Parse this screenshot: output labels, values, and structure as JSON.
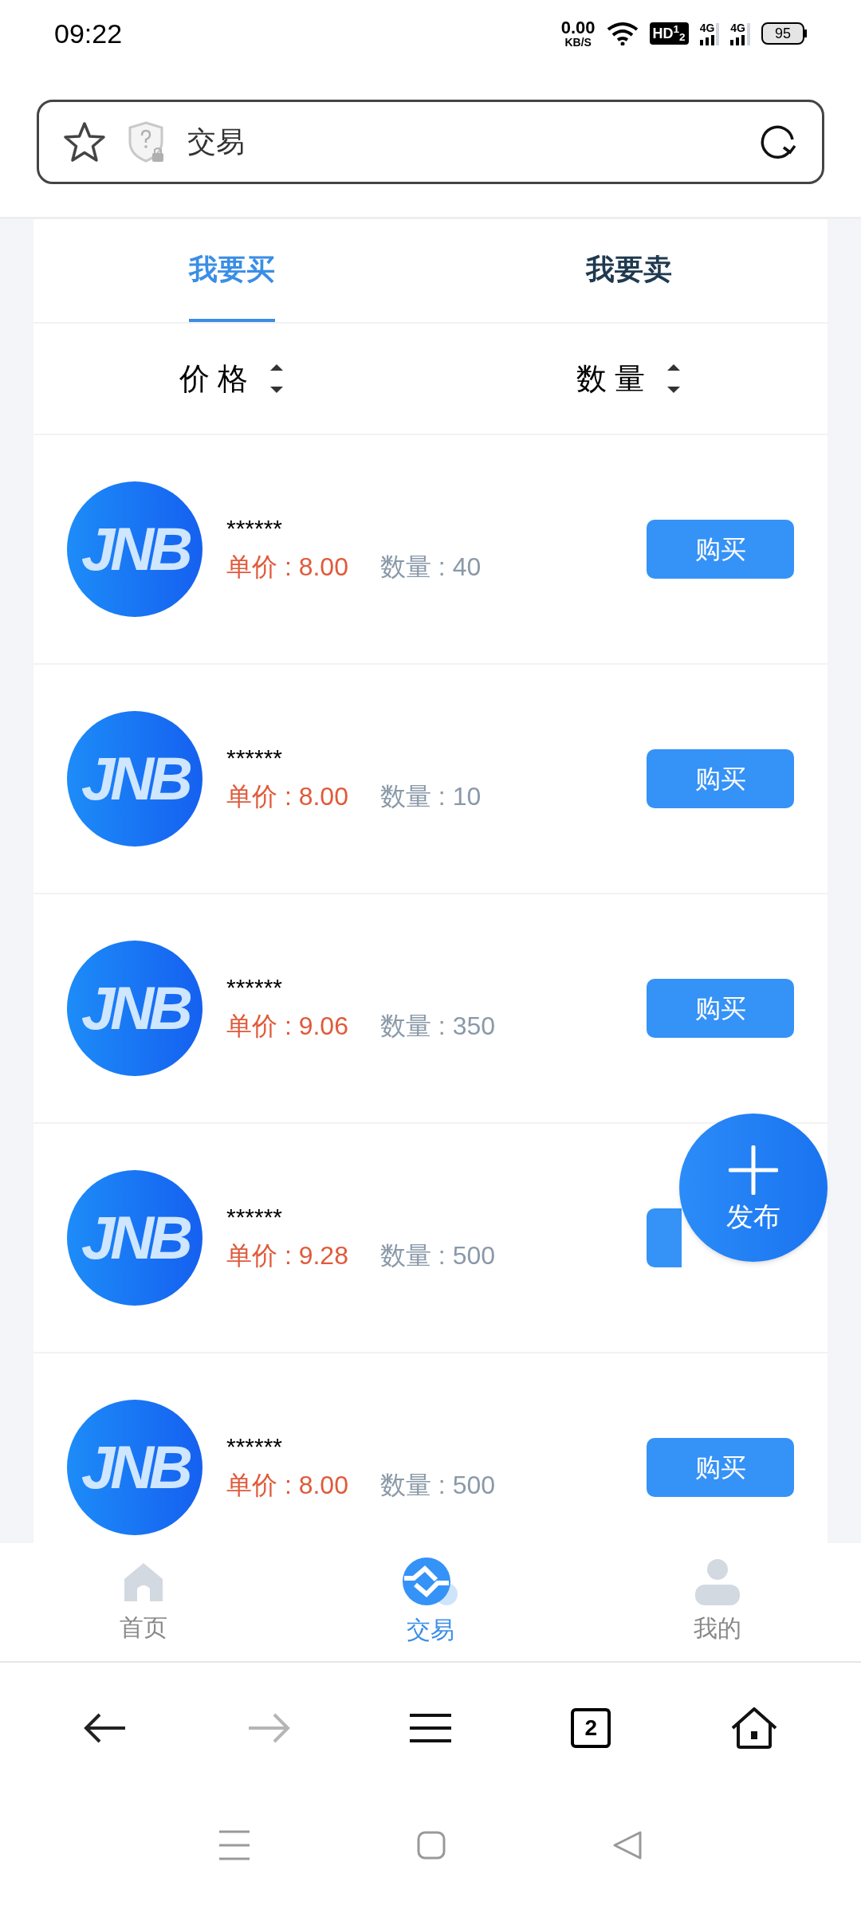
{
  "status_bar": {
    "time": "09:22",
    "speed": "0.00",
    "speed_unit": "KB/S",
    "hd": "HD$^{1}$$_{2}$",
    "networks": [
      "4G",
      "4G"
    ],
    "battery": "95"
  },
  "address_bar": {
    "title": "交易"
  },
  "tabs": [
    {
      "label": "我要买",
      "selected": true
    },
    {
      "label": "我要卖",
      "selected": false
    }
  ],
  "sort_options": [
    {
      "label": "价 格"
    },
    {
      "label": "数 量"
    }
  ],
  "listings": [
    {
      "logo": "JNB",
      "name": "******",
      "price": "单价 : 8.00",
      "quantity": "数量 : 40",
      "button": "购买"
    },
    {
      "logo": "JNB",
      "name": "******",
      "price": "单价 : 8.00",
      "quantity": "数量 : 10",
      "button": "购买"
    },
    {
      "logo": "JNB",
      "name": "******",
      "price": "单价 : 9.06",
      "quantity": "数量 : 350",
      "button": "购买"
    },
    {
      "logo": "JNB",
      "name": "******",
      "price": "单价 : 9.28",
      "quantity": "数量 : 500"
    },
    {
      "logo": "JNB",
      "name": "******",
      "price": "单价 : 8.00",
      "quantity": "数量 : 500",
      "button": "购买"
    }
  ],
  "publish_button": {
    "label": "发布"
  },
  "bottom_nav": [
    {
      "kind": "home",
      "label": "首页",
      "selected": false
    },
    {
      "kind": "trade",
      "label": "交易",
      "selected": true
    },
    {
      "kind": "profile",
      "label": "我的",
      "selected": false
    }
  ],
  "browser_bar": {
    "forward_disabled": true,
    "tab_count": "2"
  }
}
